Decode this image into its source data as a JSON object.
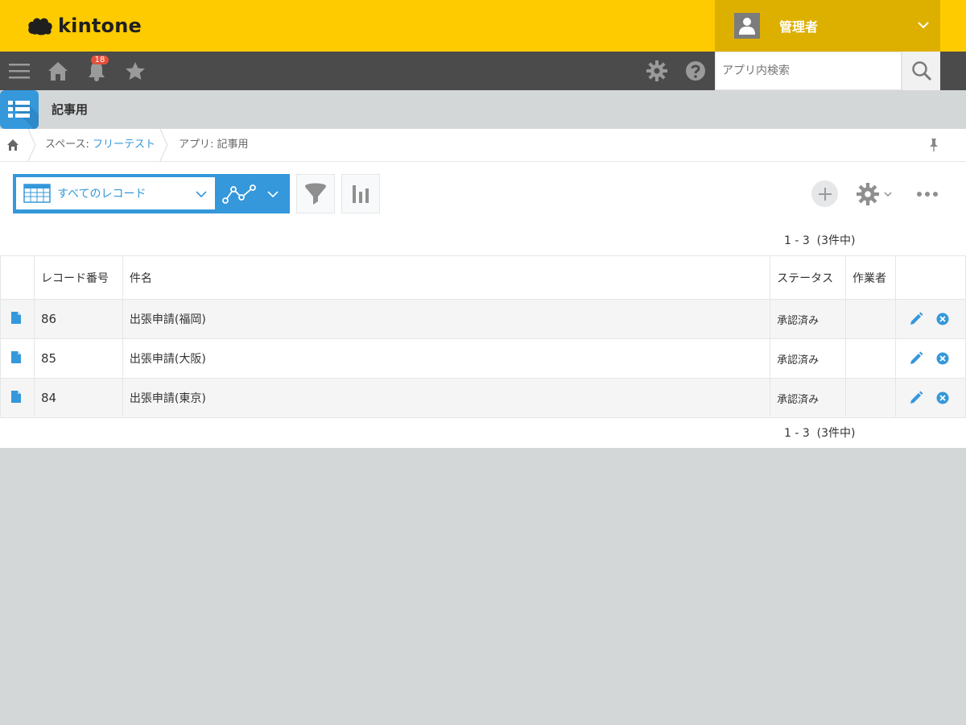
{
  "header": {
    "logo_text": "kintone",
    "user_name": "管理者",
    "brand_color": "#fdcb00"
  },
  "nav": {
    "menu_icon": "hamburger-icon",
    "home_icon": "home-icon",
    "notification_icon": "bell-icon",
    "notification_count": "18",
    "favorites_icon": "star-icon",
    "settings_icon": "gear-icon",
    "help_icon": "help-icon",
    "search_placeholder": "アプリ内検索",
    "search_icon": "search-icon"
  },
  "app": {
    "title": "記事用",
    "icon": "table-list-icon"
  },
  "breadcrumb": {
    "space_prefix": "スペース: ",
    "space_name": "フリーテスト",
    "app_label": "アプリ: 記事用"
  },
  "toolbar": {
    "view_name": "すべてのレコード",
    "graph_icon": "graph-icon",
    "filter_icon": "filter-icon",
    "chart_icon": "bar-chart-icon",
    "add_icon": "plus-icon",
    "settings_icon": "gear-icon",
    "more_icon": "more-icon",
    "accent_color": "#3498db"
  },
  "pagination": {
    "top": "1 - 3  (3件中)",
    "bottom": "1 - 3  (3件中)"
  },
  "table": {
    "headers": {
      "record_number": "レコード番号",
      "title": "件名",
      "status": "ステータス",
      "worker": "作業者"
    },
    "rows": [
      {
        "record_number": "86",
        "title": "出張申請(福岡)",
        "status": "承認済み",
        "worker": ""
      },
      {
        "record_number": "85",
        "title": "出張申請(大阪)",
        "status": "承認済み",
        "worker": ""
      },
      {
        "record_number": "84",
        "title": "出張申請(東京)",
        "status": "承認済み",
        "worker": ""
      }
    ]
  }
}
